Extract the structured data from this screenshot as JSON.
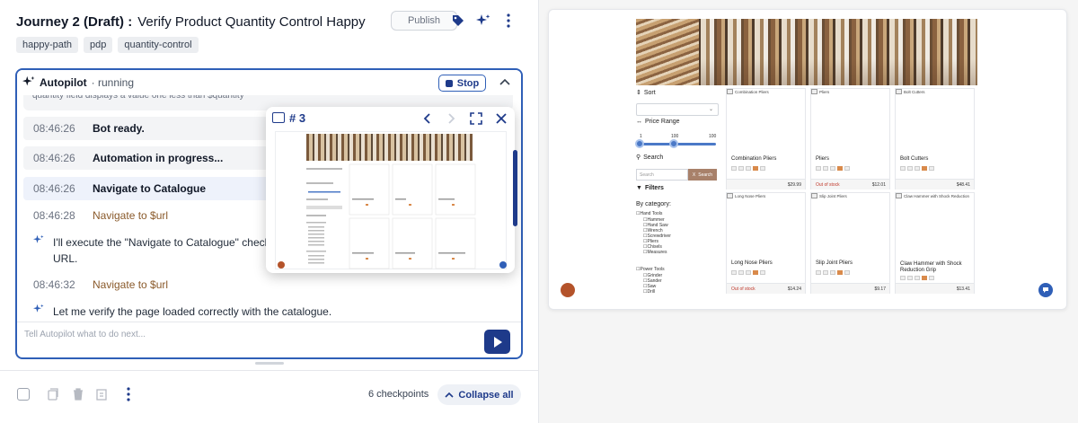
{
  "journey": {
    "title": "Journey 2 (Draft) :",
    "subtitle": "Verify Product Quantity Control Happy P...",
    "publish_label": "Publish",
    "tags": [
      "happy-path",
      "pdp",
      "quantity-control"
    ]
  },
  "autopilot": {
    "title": "Autopilot",
    "status": "· running",
    "stop_label": "Stop",
    "truncated_bubble": "quantity field displays a value one less than $quantity",
    "log": [
      {
        "time": "08:46:26",
        "message": "Bot ready.",
        "style": "bold"
      },
      {
        "time": "08:46:26",
        "message": "Automation in progress...",
        "style": "bold"
      },
      {
        "time": "08:46:26",
        "message": "Navigate to Catalogue",
        "style": "bold"
      },
      {
        "time": "08:46:28",
        "message": "Navigate to $url",
        "style": "brown"
      },
      {
        "time": "08:46:32",
        "message": "Navigate to $url",
        "style": "brown"
      }
    ],
    "ai_messages": [
      "I'll execute the \"Navigate to Catalogue\" check URL.",
      "Let me verify the page loaded correctly with the catalogue."
    ],
    "input_placeholder": "Tell Autopilot what to do next..."
  },
  "popup": {
    "number": "# 3"
  },
  "footer": {
    "checkpoints": "6 checkpoints",
    "collapse_label": "Collapse all"
  },
  "site": {
    "sort_label": "Sort",
    "price_range_label": "Price Range",
    "slider_min": "1",
    "slider_mid": "100",
    "slider_max": "100",
    "search_label": "Search",
    "search_placeholder": "Search",
    "search_button": "Search",
    "filters_label": "Filters",
    "by_category_label": "By category:",
    "hand_tools_label": "Hand Tools",
    "hand_tools": [
      "Hammer",
      "Hand Saw",
      "Wrench",
      "Screwdriver",
      "Pliers",
      "Chisels",
      "Measures"
    ],
    "power_tools_label": "Power Tools",
    "power_tools": [
      "Grinder",
      "Sander",
      "Saw",
      "Drill"
    ],
    "products": [
      {
        "img_alt": "Combination Pliers",
        "name": "Combination Pliers",
        "stock": "",
        "price": "$29.99"
      },
      {
        "img_alt": "Pliers",
        "name": "Pliers",
        "stock": "Out of stock",
        "price": "$12.01"
      },
      {
        "img_alt": "Bolt Cutters",
        "name": "Bolt Cutters",
        "stock": "",
        "price": "$48.41"
      },
      {
        "img_alt": "Long Nose Pliers",
        "name": "Long Nose Pliers",
        "stock": "Out of stock",
        "price": "$14.24"
      },
      {
        "img_alt": "Slip Joint Pliers",
        "name": "Slip Joint Pliers",
        "stock": "",
        "price": "$9.17"
      },
      {
        "img_alt": "Claw Hammer with Shock Reduction",
        "name": "Claw Hammer with Shock Reduction Grip",
        "stock": "",
        "price": "$13.41"
      }
    ]
  },
  "colors": {
    "accent": "#1e3a8a",
    "panel_border": "#2f5fb7",
    "brown_text": "#8a5a2b",
    "stock_red": "#c0392b"
  }
}
